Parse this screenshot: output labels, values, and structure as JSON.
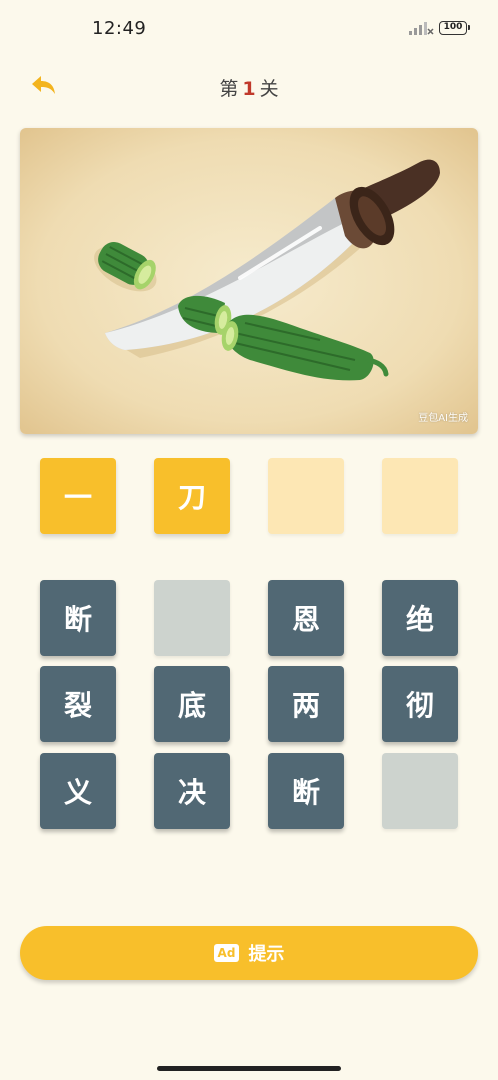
{
  "status_bar": {
    "time": "12:49",
    "battery": "100"
  },
  "header": {
    "level_prefix": "第",
    "level_number": "1",
    "level_suffix": "关"
  },
  "picture": {
    "watermark": "豆包AI生成"
  },
  "answer_slots": [
    {
      "char": "一",
      "state": "filled"
    },
    {
      "char": "刀",
      "state": "filled"
    },
    {
      "char": "",
      "state": "empty"
    },
    {
      "char": "",
      "state": "empty"
    }
  ],
  "candidates": [
    {
      "char": "断",
      "state": "active"
    },
    {
      "char": "",
      "state": "used"
    },
    {
      "char": "恩",
      "state": "active"
    },
    {
      "char": "绝",
      "state": "active"
    },
    {
      "char": "裂",
      "state": "active"
    },
    {
      "char": "底",
      "state": "active"
    },
    {
      "char": "两",
      "state": "active"
    },
    {
      "char": "彻",
      "state": "active"
    },
    {
      "char": "义",
      "state": "active"
    },
    {
      "char": "决",
      "state": "active"
    },
    {
      "char": "断",
      "state": "active"
    },
    {
      "char": "",
      "state": "used"
    }
  ],
  "hint_button": {
    "ad_label": "Ad",
    "label": "提示"
  },
  "colors": {
    "accent": "#f8bf2b",
    "tile": "#516874",
    "tile_used": "#cdd3ce",
    "slot_empty": "#fde7b4",
    "background": "#fcf9ec",
    "level_number": "#c0392b"
  }
}
